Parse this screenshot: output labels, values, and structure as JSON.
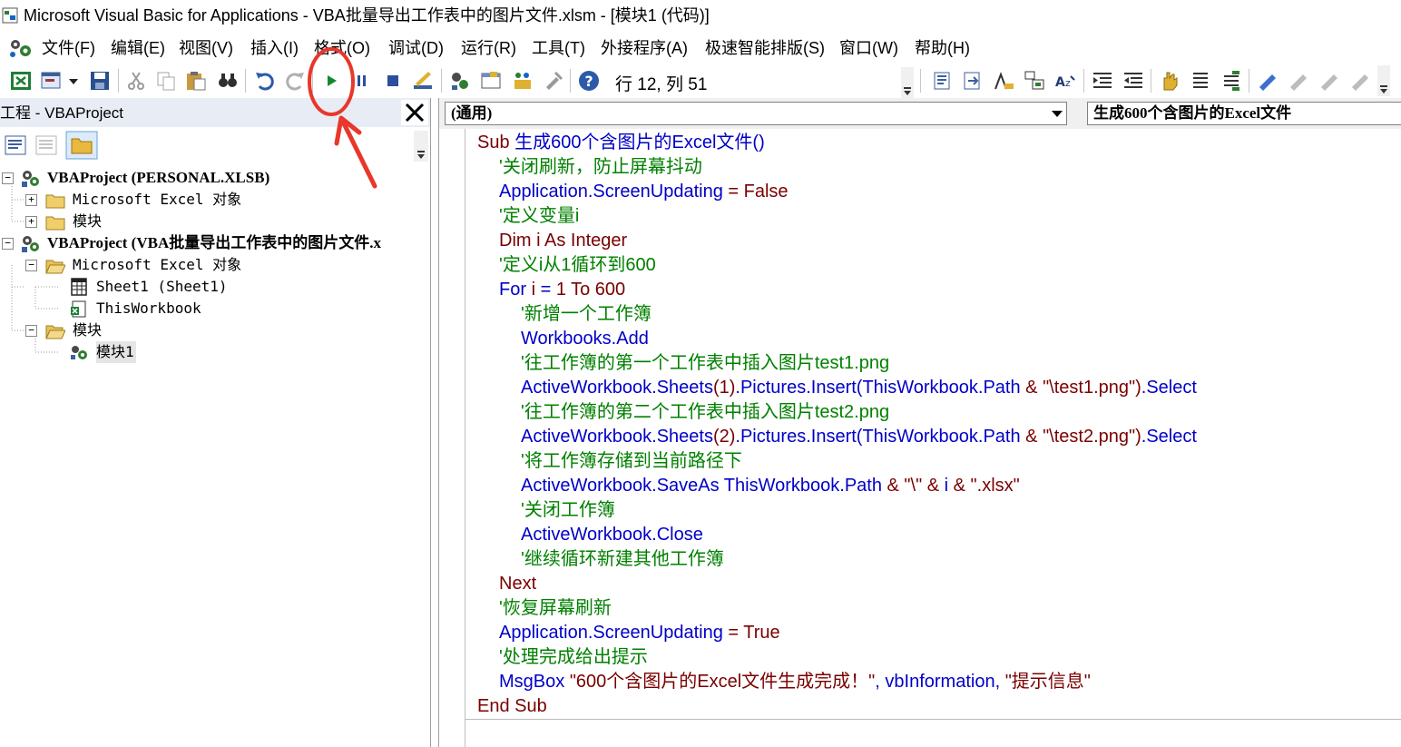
{
  "window": {
    "title": "Microsoft Visual Basic for Applications - VBA批量导出工作表中的图片文件.xlsm - [模块1 (代码)]"
  },
  "menubar": {
    "items": [
      "文件(F)",
      "编辑(E)",
      "视图(V)",
      "插入(I)",
      "格式(O)",
      "调试(D)",
      "运行(R)",
      "工具(T)",
      "外接程序(A)",
      "极速智能排版(S)",
      "窗口(W)",
      "帮助(H)"
    ]
  },
  "toolbar": {
    "cursor_position": "行 12, 列 51"
  },
  "project_panel": {
    "title": "工程 - VBAProject",
    "tree": [
      {
        "label": "VBAProject (PERSONAL.XLSB)",
        "level": 0,
        "toggle": "−",
        "icon": "vba-project-icon"
      },
      {
        "label": "Microsoft Excel 对象",
        "level": 1,
        "toggle": "+",
        "icon": "folder-icon"
      },
      {
        "label": "模块",
        "level": 1,
        "toggle": "+",
        "icon": "folder-icon"
      },
      {
        "label": "VBAProject (VBA批量导出工作表中的图片文件.x",
        "level": 0,
        "toggle": "−",
        "icon": "vba-project-icon"
      },
      {
        "label": "Microsoft Excel 对象",
        "level": 1,
        "toggle": "−",
        "icon": "open-folder-icon"
      },
      {
        "label": "Sheet1 (Sheet1)",
        "level": 2,
        "toggle": "",
        "icon": "worksheet-icon"
      },
      {
        "label": "ThisWorkbook",
        "level": 2,
        "toggle": "",
        "icon": "workbook-icon"
      },
      {
        "label": "模块",
        "level": 1,
        "toggle": "−",
        "icon": "open-folder-icon"
      },
      {
        "label": "模块1",
        "level": 2,
        "toggle": "",
        "icon": "module-icon",
        "selected": true
      }
    ]
  },
  "code_window": {
    "object_combo": "(通用)",
    "procedure_combo": "生成600个含图片的Excel文件",
    "lines": [
      {
        "indent": 0,
        "parts": [
          {
            "t": "Sub ",
            "c": "kw"
          },
          {
            "t": "生成600个含图片的Excel文件()",
            "c": "id"
          }
        ]
      },
      {
        "indent": 1,
        "parts": [
          {
            "t": "'关闭刷新，防止屏幕抖动",
            "c": "cm"
          }
        ]
      },
      {
        "indent": 1,
        "parts": [
          {
            "t": "Application.ScreenUpdating",
            "c": "id"
          },
          {
            "t": " = ",
            "c": "kw"
          },
          {
            "t": "False",
            "c": "kw"
          }
        ]
      },
      {
        "indent": 1,
        "parts": [
          {
            "t": "'定义变量i",
            "c": "cm"
          }
        ]
      },
      {
        "indent": 1,
        "parts": [
          {
            "t": "Dim i As Integer",
            "c": "kw"
          }
        ]
      },
      {
        "indent": 1,
        "parts": [
          {
            "t": "'定义i从1循环到600",
            "c": "cm"
          }
        ]
      },
      {
        "indent": 1,
        "parts": [
          {
            "t": "For ",
            "c": "id"
          },
          {
            "t": "i",
            "c": "kw"
          },
          {
            "t": " = ",
            "c": "id"
          },
          {
            "t": "1 To 600",
            "c": "kw"
          }
        ]
      },
      {
        "indent": 2,
        "parts": [
          {
            "t": "'新增一个工作簿",
            "c": "cm"
          }
        ]
      },
      {
        "indent": 2,
        "parts": [
          {
            "t": "Workbooks.Add",
            "c": "id"
          }
        ]
      },
      {
        "indent": 2,
        "parts": [
          {
            "t": "'往工作簿的第一个工作表中插入图片test1.png",
            "c": "cm"
          }
        ]
      },
      {
        "indent": 2,
        "parts": [
          {
            "t": "ActiveWorkbook.Sheets",
            "c": "id"
          },
          {
            "t": "(1)",
            "c": "kw"
          },
          {
            "t": ".Pictures.Insert(ThisWorkbook.Path",
            "c": "id"
          },
          {
            "t": " & \"\\test1.png\")",
            "c": "kw"
          },
          {
            "t": ".Select",
            "c": "id"
          }
        ]
      },
      {
        "indent": 2,
        "parts": [
          {
            "t": "'往工作簿的第二个工作表中插入图片test2.png",
            "c": "cm"
          }
        ]
      },
      {
        "indent": 2,
        "parts": [
          {
            "t": "ActiveWorkbook.Sheets",
            "c": "id"
          },
          {
            "t": "(2)",
            "c": "kw"
          },
          {
            "t": ".Pictures.Insert(ThisWorkbook.Path",
            "c": "id"
          },
          {
            "t": " & \"\\test2.png\")",
            "c": "kw"
          },
          {
            "t": ".Select",
            "c": "id"
          }
        ]
      },
      {
        "indent": 2,
        "parts": [
          {
            "t": "'将工作簿存储到当前路径下",
            "c": "cm"
          }
        ]
      },
      {
        "indent": 2,
        "parts": [
          {
            "t": "ActiveWorkbook.SaveAs ThisWorkbook.Path",
            "c": "id"
          },
          {
            "t": " & \"\\\" & ",
            "c": "kw"
          },
          {
            "t": "i",
            "c": "id"
          },
          {
            "t": " & \".xlsx\"",
            "c": "kw"
          }
        ]
      },
      {
        "indent": 2,
        "parts": [
          {
            "t": "'关闭工作簿",
            "c": "cm"
          }
        ]
      },
      {
        "indent": 2,
        "parts": [
          {
            "t": "ActiveWorkbook.Close",
            "c": "id"
          }
        ]
      },
      {
        "indent": 2,
        "parts": [
          {
            "t": "'继续循环新建其他工作簿",
            "c": "cm"
          }
        ]
      },
      {
        "indent": 1,
        "parts": [
          {
            "t": "Next",
            "c": "kw"
          }
        ]
      },
      {
        "indent": 1,
        "parts": [
          {
            "t": "'恢复屏幕刷新",
            "c": "cm"
          }
        ]
      },
      {
        "indent": 1,
        "parts": [
          {
            "t": "Application.ScreenUpdating",
            "c": "id"
          },
          {
            "t": " = ",
            "c": "kw"
          },
          {
            "t": "True",
            "c": "kw"
          }
        ]
      },
      {
        "indent": 1,
        "parts": [
          {
            "t": "'处理完成给出提示",
            "c": "cm"
          }
        ]
      },
      {
        "indent": 1,
        "parts": [
          {
            "t": "MsgBox ",
            "c": "id"
          },
          {
            "t": "\"600个含图片的Excel文件生成完成！\"",
            "c": "kw"
          },
          {
            "t": ", vbInformation, ",
            "c": "id"
          },
          {
            "t": "\"提示信息\"",
            "c": "kw"
          }
        ]
      },
      {
        "indent": 0,
        "parts": [
          {
            "t": "End Sub",
            "c": "kw"
          }
        ]
      }
    ]
  },
  "colors": {
    "keyword": "#7a0000",
    "identifier": "#0000c8",
    "comment": "#008000",
    "annotation": "#e8372b"
  }
}
